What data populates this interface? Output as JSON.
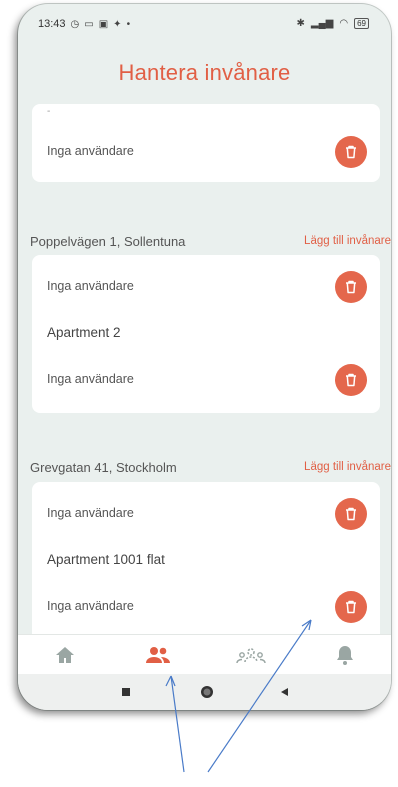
{
  "status_bar": {
    "time": "13:43",
    "battery": "69"
  },
  "header": {
    "title": "Hantera invånare"
  },
  "top_card": {
    "partial_label": "-",
    "row_label": "Inga användare"
  },
  "sections": [
    {
      "address": "Poppelvägen 1, Sollentuna",
      "add_label": "Lägg till invånare",
      "rows": [
        {
          "label": "Inga användare"
        },
        {
          "apartment": "Apartment 2"
        },
        {
          "label": "Inga användare"
        }
      ]
    },
    {
      "address": "Grevgatan 41, Stockholm",
      "add_label": "Lägg till invånare",
      "rows": [
        {
          "label": "Inga användare"
        },
        {
          "apartment": "Apartment 1001 flat"
        },
        {
          "label": "Inga användare"
        }
      ]
    }
  ],
  "bottom_nav": {
    "items": [
      {
        "icon": "home-icon",
        "active": false
      },
      {
        "icon": "residents-icon",
        "active": true
      },
      {
        "icon": "community-icon",
        "active": false
      },
      {
        "icon": "bell-icon",
        "active": false
      }
    ]
  },
  "colors": {
    "accent": "#e15f45",
    "background": "#eaf0ee",
    "card": "#ffffff",
    "inactive_icon": "#9aa6a3"
  }
}
